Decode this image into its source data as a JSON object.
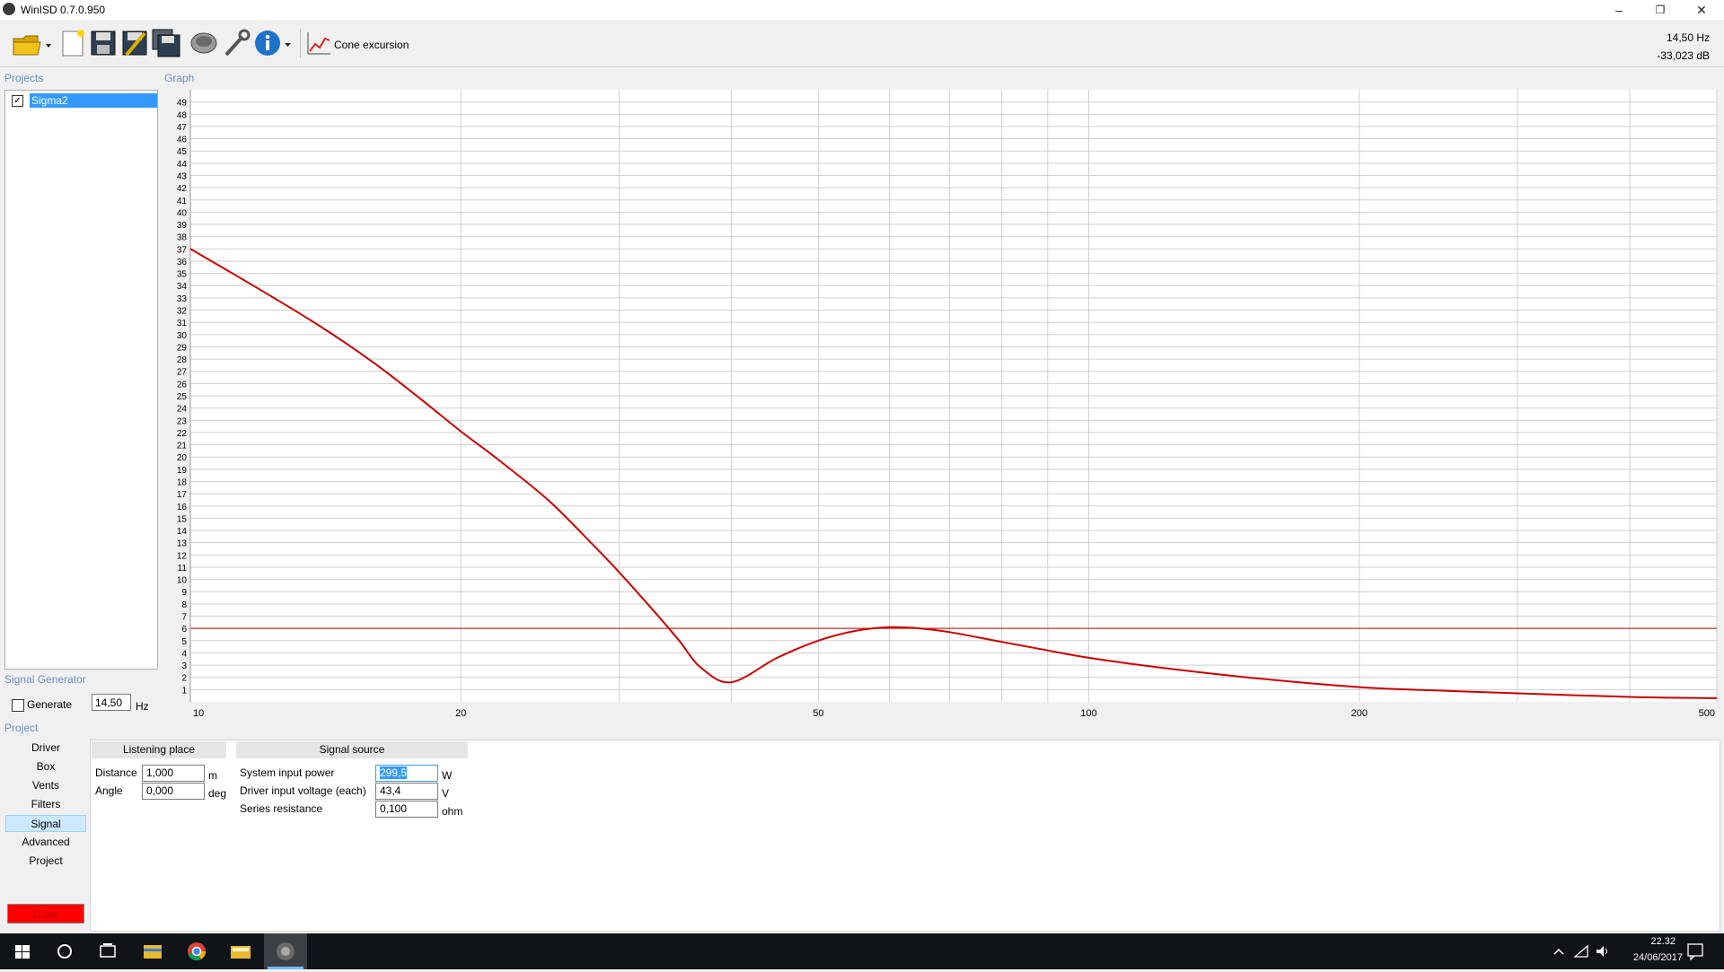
{
  "window": {
    "title": "WinISD 0.7.0.950",
    "controls": [
      "minimize",
      "restore",
      "close"
    ]
  },
  "toolbar": {
    "buttons": [
      "open-icon",
      "new-project-icon",
      "save-icon",
      "save-as-icon",
      "save-all-icon",
      "driver-icon",
      "tools-icon",
      "info-icon"
    ],
    "graph_label": "Cone excursion",
    "readout": {
      "frequency": "14,50 Hz",
      "level": "-33,023 dB"
    }
  },
  "sidebar": {
    "projects_heading": "Projects",
    "projects": [
      {
        "name": "Sigma2",
        "checked": true
      }
    ],
    "signal_generator_heading": "Signal Generator",
    "generate_label": "Generate",
    "generate_checked": false,
    "generate_frequency": "14,50",
    "generate_unit": "Hz"
  },
  "graph": {
    "heading": "Graph"
  },
  "chart_data": {
    "type": "line",
    "title": "",
    "xlabel": "",
    "ylabel": "",
    "x_scale": "log",
    "xlim": [
      10,
      500
    ],
    "ylim": [
      0,
      50
    ],
    "x_tick_labels": [
      "10",
      "20",
      "50",
      "100",
      "200",
      "500"
    ],
    "y_tick_labels": [
      "1",
      "2",
      "3",
      "4",
      "5",
      "6",
      "7",
      "8",
      "9",
      "10",
      "11",
      "12",
      "13",
      "14",
      "15",
      "16",
      "17",
      "18",
      "19",
      "20",
      "21",
      "22",
      "23",
      "24",
      "25",
      "26",
      "27",
      "28",
      "29",
      "30",
      "31",
      "32",
      "33",
      "34",
      "35",
      "36",
      "37",
      "38",
      "39",
      "40",
      "41",
      "42",
      "43",
      "44",
      "45",
      "46",
      "47",
      "48",
      "49"
    ],
    "grid": true,
    "legend": "none",
    "series": [
      {
        "x": [
          10,
          12,
          14,
          16,
          18,
          20,
          22,
          25,
          28,
          30,
          33,
          35,
          37,
          40,
          45,
          50,
          55,
          60,
          65,
          70,
          80,
          90,
          100,
          120,
          150,
          200,
          250,
          300,
          400,
          500
        ],
        "y": [
          37,
          33.6,
          30.6,
          27.7,
          24.8,
          22.1,
          19.8,
          16.5,
          12.9,
          10.6,
          7.2,
          5.0,
          2.8,
          1.6,
          3.6,
          5.0,
          5.8,
          6.1,
          6.0,
          5.7,
          4.9,
          4.2,
          3.6,
          2.8,
          2.0,
          1.2,
          0.9,
          0.7,
          0.4,
          0.3
        ],
        "color": "#cc0000"
      }
    ],
    "reference_line": {
      "y": 6,
      "color": "#cc0000"
    }
  },
  "project_panel": {
    "heading": "Project",
    "nav": [
      "Driver",
      "Box",
      "Vents",
      "Filters",
      "Signal",
      "Advanced",
      "Project"
    ],
    "active_nav": "Signal",
    "color_button": "Color",
    "color_value": "#ff0000",
    "listening_place": {
      "title": "Listening place",
      "fields": [
        {
          "label": "Distance",
          "value": "1,000",
          "unit": "m"
        },
        {
          "label": "Angle",
          "value": "0,000",
          "unit": "deg"
        }
      ]
    },
    "signal_source": {
      "title": "Signal source",
      "fields": [
        {
          "label": "System input power",
          "value": "299,5",
          "unit": "W"
        },
        {
          "label": "Driver input voltage (each)",
          "value": "43,4",
          "unit": "V"
        },
        {
          "label": "Series resistance",
          "value": "0,100",
          "unit": "ohm"
        }
      ]
    }
  },
  "taskbar": {
    "icons": [
      "windows-start-icon",
      "search-icon",
      "task-view-icon",
      "file-explorer-icon",
      "chrome-icon",
      "folder-icon",
      "winisd-icon"
    ],
    "tray_icons": [
      "chevron-up-icon",
      "network-icon",
      "volume-icon"
    ],
    "time": "22.32",
    "date": "24/06/2017"
  }
}
